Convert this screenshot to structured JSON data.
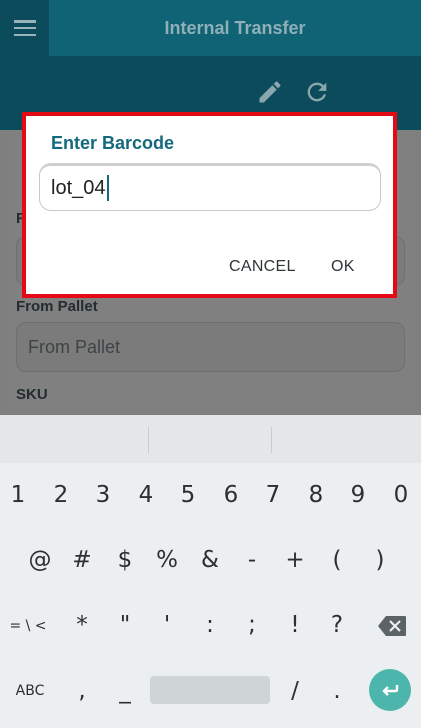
{
  "appbar": {
    "title": "Internal Transfer"
  },
  "form": {
    "from_location_label_partial": "Fr",
    "from_pallet_label": "From Pallet",
    "from_pallet_placeholder": "From Pallet",
    "sku_label": "SKU"
  },
  "dialog": {
    "title": "Enter Barcode",
    "input_value": "lot_04",
    "cancel_label": "CANCEL",
    "ok_label": "OK"
  },
  "keyboard": {
    "row1": [
      "1",
      "2",
      "3",
      "4",
      "5",
      "6",
      "7",
      "8",
      "9",
      "0"
    ],
    "row2": [
      "@",
      "#",
      "$",
      "%",
      "&",
      "-",
      "+",
      "(",
      ")"
    ],
    "row3": [
      "= \\ <",
      "*",
      "\"",
      "'",
      ":",
      ";",
      "!",
      "?"
    ],
    "row4": [
      "ABC",
      ",",
      "_",
      "/",
      "."
    ]
  },
  "colors": {
    "header_dark": "#0b4b5b",
    "header_title_bg": "#0f6375",
    "dialog_title": "#136a7e",
    "highlight_border": "#e50914",
    "enter_key": "#4db6ac"
  }
}
